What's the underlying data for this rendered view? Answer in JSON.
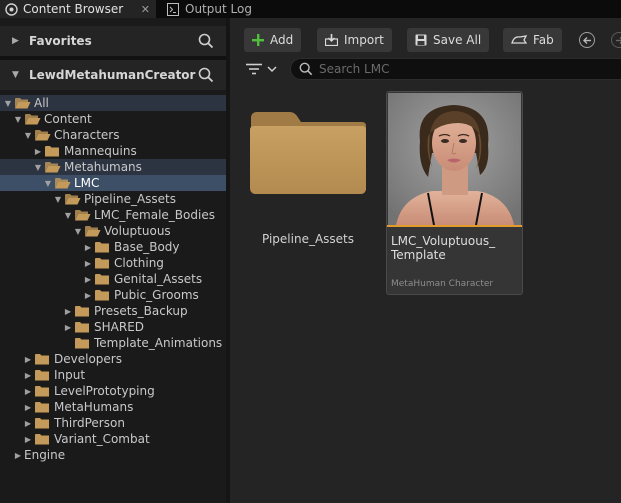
{
  "tabs": [
    {
      "label": "Content Browser",
      "icon": "content-browser-icon",
      "active": true
    },
    {
      "label": "Output Log",
      "icon": "output-log-icon",
      "active": false
    }
  ],
  "favorites": {
    "label": "Favorites"
  },
  "project": {
    "label": "LewdMetahumanCreator"
  },
  "tree": [
    {
      "label": "All",
      "depth": 0,
      "expanded": true,
      "state": "hl"
    },
    {
      "label": "Content",
      "depth": 1,
      "expanded": true,
      "state": ""
    },
    {
      "label": "Characters",
      "depth": 2,
      "expanded": true,
      "state": ""
    },
    {
      "label": "Mannequins",
      "depth": 3,
      "expanded": false,
      "state": ""
    },
    {
      "label": "Metahumans",
      "depth": 3,
      "expanded": true,
      "state": "hl"
    },
    {
      "label": "LMC",
      "depth": 4,
      "expanded": true,
      "state": "sel"
    },
    {
      "label": "Pipeline_Assets",
      "depth": 5,
      "expanded": true,
      "state": ""
    },
    {
      "label": "LMC_Female_Bodies",
      "depth": 6,
      "expanded": true,
      "state": ""
    },
    {
      "label": "Voluptuous",
      "depth": 7,
      "expanded": true,
      "state": ""
    },
    {
      "label": "Base_Body",
      "depth": 8,
      "expanded": false,
      "state": ""
    },
    {
      "label": "Clothing",
      "depth": 8,
      "expanded": false,
      "state": ""
    },
    {
      "label": "Genital_Assets",
      "depth": 8,
      "expanded": false,
      "state": ""
    },
    {
      "label": "Pubic_Grooms",
      "depth": 8,
      "expanded": false,
      "state": ""
    },
    {
      "label": "Presets_Backup",
      "depth": 6,
      "expanded": false,
      "state": ""
    },
    {
      "label": "SHARED",
      "depth": 6,
      "expanded": false,
      "state": ""
    },
    {
      "label": "Template_Animations",
      "depth": 6,
      "expanded": null,
      "state": ""
    },
    {
      "label": "Developers",
      "depth": 2,
      "expanded": false,
      "state": ""
    },
    {
      "label": "Input",
      "depth": 2,
      "expanded": false,
      "state": ""
    },
    {
      "label": "LevelPrototyping",
      "depth": 2,
      "expanded": false,
      "state": ""
    },
    {
      "label": "MetaHumans",
      "depth": 2,
      "expanded": false,
      "state": ""
    },
    {
      "label": "ThirdPerson",
      "depth": 2,
      "expanded": false,
      "state": ""
    },
    {
      "label": "Variant_Combat",
      "depth": 2,
      "expanded": false,
      "state": ""
    },
    {
      "label": "Engine",
      "depth": 1,
      "expanded": false,
      "state": "",
      "noFolder": true
    }
  ],
  "toolbar": {
    "add_label": "Add",
    "import_label": "Import",
    "save_all_label": "Save All",
    "fab_label": "Fab"
  },
  "search": {
    "placeholder": "Search LMC"
  },
  "assets": {
    "folder_label": "Pipeline_Assets",
    "card_name": "LMC_Voluptuous_\nTemplate",
    "card_type": "MetaHuman Character"
  },
  "colors": {
    "folder": "#c49a5a",
    "accent_bar": "#e39a2c",
    "selection": "#3c4f66",
    "add_green": "#4fbf3c"
  }
}
